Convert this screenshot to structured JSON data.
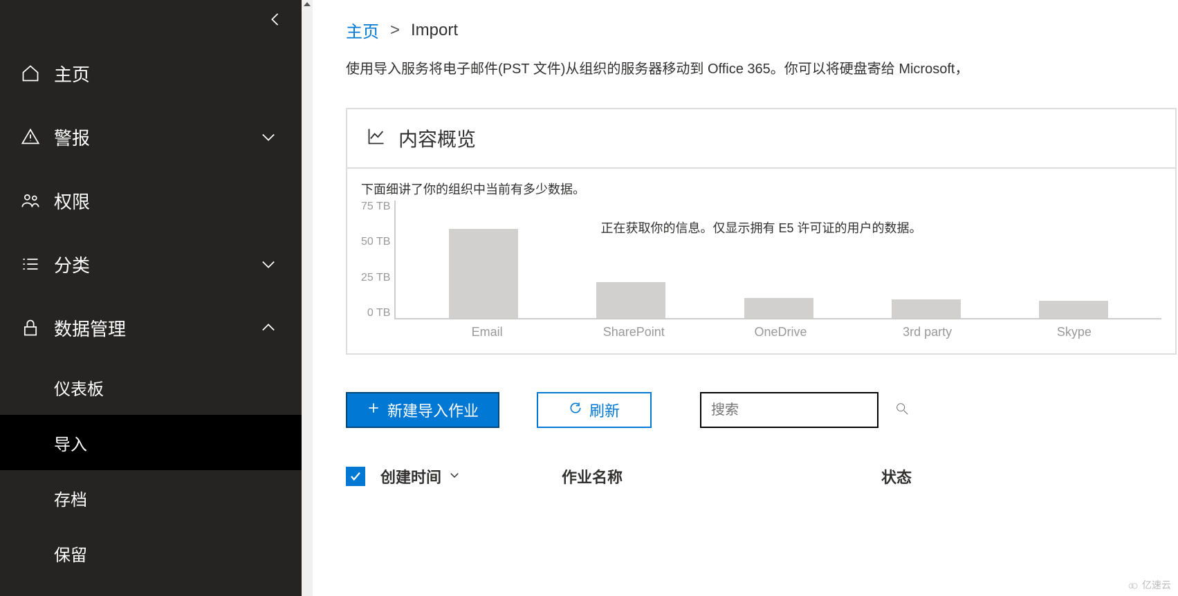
{
  "sidebar": {
    "items": [
      {
        "label": "主页"
      },
      {
        "label": "警报"
      },
      {
        "label": "权限"
      },
      {
        "label": "分类"
      },
      {
        "label": "数据管理"
      }
    ],
    "sub": {
      "dashboard": "仪表板",
      "import": "导入",
      "archive": "存档",
      "retention": "保留"
    }
  },
  "breadcrumb": {
    "home": "主页",
    "current": "Import"
  },
  "desc": "使用导入服务将电子邮件(PST 文件)从组织的服务器移动到 Office 365。你可以将硬盘寄给 Microsoft，",
  "card": {
    "title": "内容概览",
    "subdesc": "下面细讲了你的组织中当前有多少数据。",
    "note": "正在获取你的信息。仅显示拥有 E5 许可证的用户的数据。"
  },
  "chart_data": {
    "type": "bar",
    "categories": [
      "Email",
      "SharePoint",
      "OneDrive",
      "3rd party",
      "Skype"
    ],
    "values": [
      57,
      23,
      13,
      12,
      11
    ],
    "title": "内容概览",
    "xlabel": "",
    "ylabel": "",
    "y_ticks": [
      "75 TB",
      "50 TB",
      "25 TB",
      "0 TB"
    ],
    "ylim": [
      0,
      75
    ],
    "unit": "TB"
  },
  "toolbar": {
    "new_job": "新建导入作业",
    "refresh": "刷新",
    "search_placeholder": "搜索"
  },
  "table": {
    "col_created": "创建时间",
    "col_name": "作业名称",
    "col_status": "状态"
  },
  "watermark": "亿速云"
}
